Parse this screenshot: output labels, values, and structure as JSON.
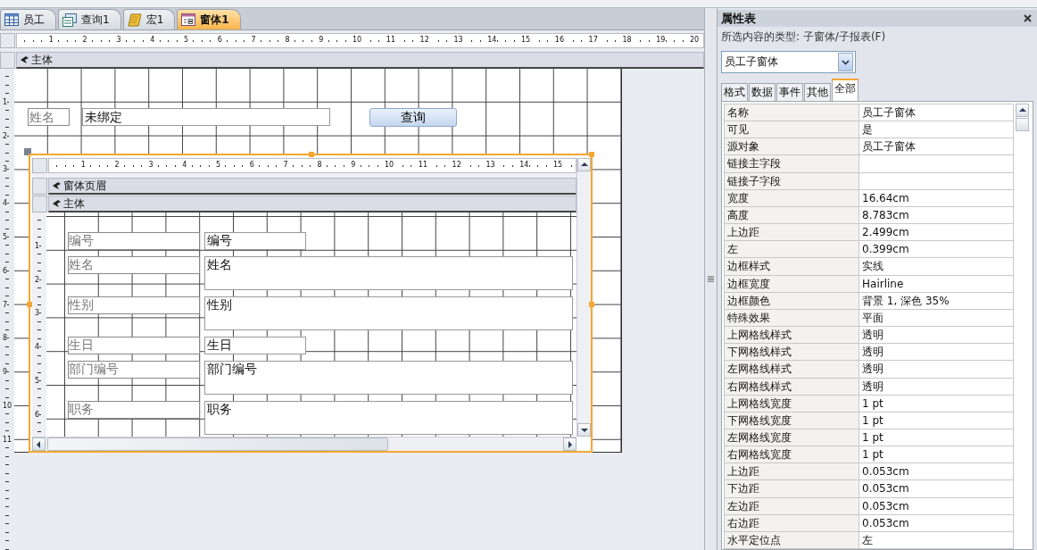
{
  "document_tabs": [
    {
      "label": "员工",
      "kind": "table",
      "selected": false
    },
    {
      "label": "查询1",
      "kind": "query",
      "selected": false
    },
    {
      "label": "宏1",
      "kind": "macro",
      "selected": false
    },
    {
      "label": "窗体1",
      "kind": "form",
      "selected": true
    }
  ],
  "designer": {
    "ruler_numbers": [
      "1",
      "2",
      "3",
      "4",
      "5",
      "6",
      "7",
      "8",
      "9",
      "10",
      "11",
      "12",
      "13",
      "14",
      "15",
      "16",
      "17",
      "18",
      "19",
      "20"
    ],
    "vertical_ruler_numbers": [
      "1",
      "2",
      "3",
      "4",
      "5",
      "6",
      "7",
      "8",
      "9",
      "10",
      "11"
    ],
    "section": "主体",
    "controls": [
      {
        "kind": "label",
        "text": "姓名"
      },
      {
        "kind": "textbox",
        "text": "未绑定"
      },
      {
        "kind": "button",
        "text": "查询"
      }
    ],
    "subform": {
      "selected": true,
      "ruler_numbers": [
        "1",
        "2",
        "3",
        "4",
        "5",
        "6",
        "7",
        "8",
        "9",
        "10",
        "11",
        "12",
        "13",
        "14",
        "15"
      ],
      "vertical_ruler_numbers": [
        "1",
        "2",
        "3",
        "4",
        "5",
        "6"
      ],
      "sections": [
        "窗体页眉",
        "主体"
      ],
      "fields": [
        {
          "label": "编号",
          "value": "编号",
          "kind": "short"
        },
        {
          "label": "姓名",
          "value": "姓名",
          "kind": "wide"
        },
        {
          "label": "性别",
          "value": "性别",
          "kind": "wide"
        },
        {
          "label": "生日",
          "value": "生日",
          "kind": "short"
        },
        {
          "label": "部门编号",
          "value": "部门编号",
          "kind": "wide"
        },
        {
          "label": "职务",
          "value": "职务",
          "kind": "wide"
        }
      ]
    }
  },
  "property_sheet": {
    "title": "属性表",
    "selection_type": "所选内容的类型: 子窗体/子报表(F)",
    "object": "员工子窗体",
    "tabs": [
      {
        "label": "格式",
        "selected": false
      },
      {
        "label": "数据",
        "selected": false
      },
      {
        "label": "事件",
        "selected": false
      },
      {
        "label": "其他",
        "selected": false
      },
      {
        "label": "全部",
        "selected": true
      }
    ],
    "properties": [
      {
        "name": "名称",
        "value": "员工子窗体"
      },
      {
        "name": "可见",
        "value": "是"
      },
      {
        "name": "源对象",
        "value": "员工子窗体"
      },
      {
        "name": "链接主字段"
      },
      {
        "name": "链接子字段"
      },
      {
        "name": "宽度",
        "value": "16.64cm"
      },
      {
        "name": "高度",
        "value": "8.783cm"
      },
      {
        "name": "上边距",
        "value": "2.499cm"
      },
      {
        "name": "左",
        "value": "0.399cm"
      },
      {
        "name": "边框样式",
        "value": "实线"
      },
      {
        "name": "边框宽度",
        "value": "Hairline"
      },
      {
        "name": "边框颜色",
        "value": "背景 1, 深色 35%"
      },
      {
        "name": "特殊效果",
        "value": "平面"
      },
      {
        "name": "上网格线样式",
        "value": "透明"
      },
      {
        "name": "下网格线样式",
        "value": "透明"
      },
      {
        "name": "左网格线样式",
        "value": "透明"
      },
      {
        "name": "右网格线样式",
        "value": "透明"
      },
      {
        "name": "上网格线宽度",
        "value": "1 pt"
      },
      {
        "name": "下网格线宽度",
        "value": "1 pt"
      },
      {
        "name": "左网格线宽度",
        "value": "1 pt"
      },
      {
        "name": "右网格线宽度",
        "value": "1 pt"
      },
      {
        "name": "上边距",
        "value": "0.053cm"
      },
      {
        "name": "下边距",
        "value": "0.053cm"
      },
      {
        "name": "左边距",
        "value": "0.053cm"
      },
      {
        "name": "右边距",
        "value": "0.053cm"
      },
      {
        "name": "水平定位点",
        "value": "左"
      }
    ]
  }
}
